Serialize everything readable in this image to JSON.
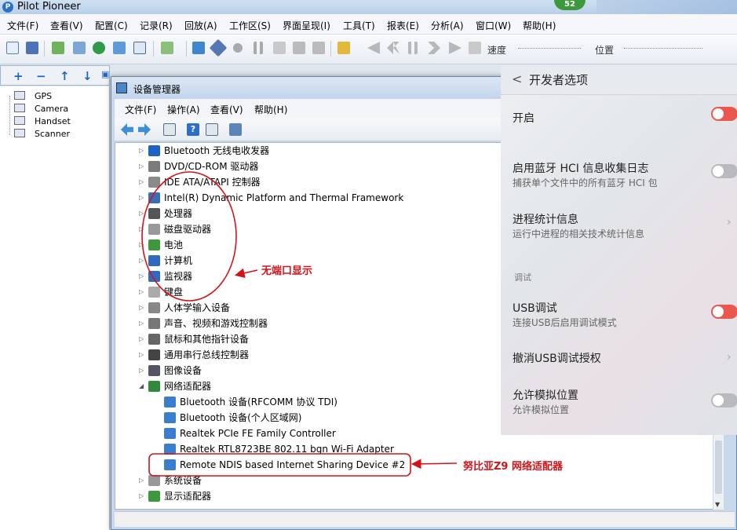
{
  "app": {
    "title": "Pilot Pioneer",
    "badge": "52"
  },
  "main_menu": [
    "文件(F)",
    "查看(V)",
    "配置(C)",
    "记录(R)",
    "回放(A)",
    "工作区(S)",
    "界面呈现(I)",
    "工具(T)",
    "报表(E)",
    "分析(A)",
    "窗口(W)",
    "帮助(H)"
  ],
  "main_toolbar": {
    "speed_label": "速度",
    "position_label": "位置"
  },
  "left_panel": {
    "items": [
      "GPS",
      "Camera",
      "Handset",
      "Scanner"
    ]
  },
  "device_manager": {
    "title": "设备管理器",
    "menu": [
      "文件(F)",
      "操作(A)",
      "查看(V)",
      "帮助(H)"
    ],
    "tree": [
      {
        "label": "Bluetooth 无线电收发器",
        "level": 0,
        "expanded": false
      },
      {
        "label": "DVD/CD-ROM 驱动器",
        "level": 0,
        "expanded": false
      },
      {
        "label": "IDE ATA/ATAPI 控制器",
        "level": 0,
        "expanded": false
      },
      {
        "label": "Intel(R) Dynamic Platform and Thermal Framework",
        "level": 0,
        "expanded": false
      },
      {
        "label": "处理器",
        "level": 0,
        "expanded": false
      },
      {
        "label": "磁盘驱动器",
        "level": 0,
        "expanded": false
      },
      {
        "label": "电池",
        "level": 0,
        "expanded": false
      },
      {
        "label": "计算机",
        "level": 0,
        "expanded": false
      },
      {
        "label": "监视器",
        "level": 0,
        "expanded": false
      },
      {
        "label": "键盘",
        "level": 0,
        "expanded": false
      },
      {
        "label": "人体学输入设备",
        "level": 0,
        "expanded": false
      },
      {
        "label": "声音、视频和游戏控制器",
        "level": 0,
        "expanded": false
      },
      {
        "label": "鼠标和其他指针设备",
        "level": 0,
        "expanded": false
      },
      {
        "label": "通用串行总线控制器",
        "level": 0,
        "expanded": false
      },
      {
        "label": "图像设备",
        "level": 0,
        "expanded": false
      },
      {
        "label": "网络适配器",
        "level": 0,
        "expanded": true
      },
      {
        "label": "Bluetooth 设备(RFCOMM 协议 TDI)",
        "level": 1
      },
      {
        "label": "Bluetooth 设备(个人区域网)",
        "level": 1
      },
      {
        "label": "Realtek PCIe FE Family Controller",
        "level": 1
      },
      {
        "label": "Realtek RTL8723BE 802.11 bgn Wi-Fi Adapter",
        "level": 1
      },
      {
        "label": "Remote NDIS based Internet Sharing Device #2",
        "level": 1
      },
      {
        "label": "系统设备",
        "level": 0,
        "expanded": false
      },
      {
        "label": "显示适配器",
        "level": 0,
        "expanded": false
      }
    ]
  },
  "phone": {
    "header": "开发者选项",
    "items": {
      "enable": {
        "title": "开启",
        "on": true
      },
      "bt_hci": {
        "title": "启用蓝牙 HCI 信息收集日志",
        "subtitle": "捕获单个文件中的所有蓝牙 HCI 包",
        "on": false
      },
      "process_stats": {
        "title": "进程统计信息",
        "subtitle": "运行中进程的相关技术统计信息"
      },
      "debug_section": "调试",
      "usb_debug": {
        "title": "USB调试",
        "subtitle": "连接USB后启用调试模式",
        "on": true
      },
      "revoke_usb": {
        "title": "撤消USB调试授权"
      },
      "mock_location": {
        "title": "允许模拟位置",
        "subtitle": "允许模拟位置",
        "on": false
      }
    }
  },
  "annotations": {
    "no_port": "无端口显示",
    "nubia": "努比亚Z9  网络适配器"
  },
  "colors": {
    "annotation": "#d2141a",
    "toggle_on": "#e9574f",
    "toggle_off": "#b8babd"
  }
}
